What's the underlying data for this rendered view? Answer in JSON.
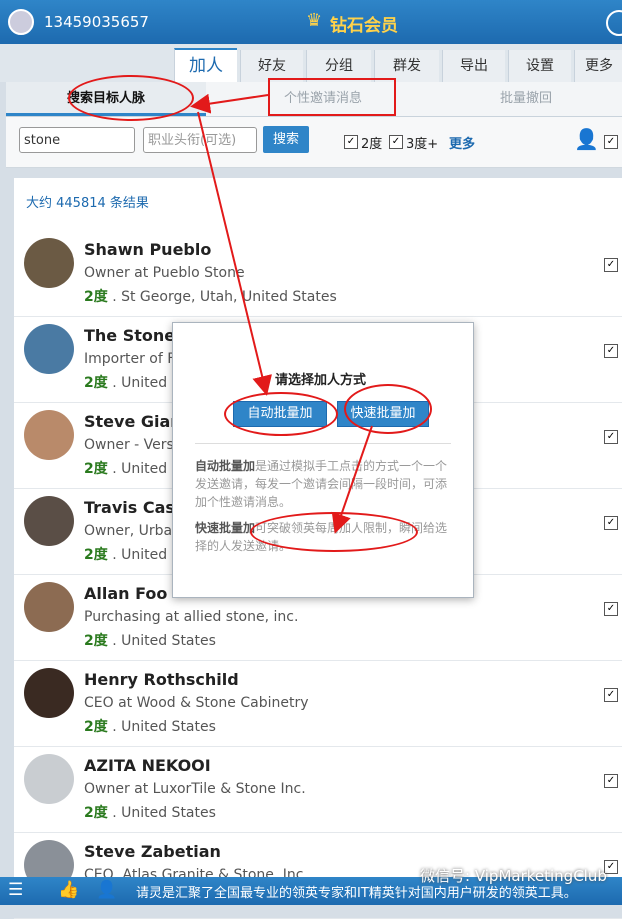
{
  "header": {
    "phone": "13459035657",
    "vip_label": "钻石会员"
  },
  "tabs": [
    "加人",
    "好友",
    "分组",
    "群发",
    "导出",
    "设置",
    "更多"
  ],
  "subtabs": [
    "搜索目标人脉",
    "个性邀请消息",
    "批量撤回"
  ],
  "search": {
    "keyword": "stone",
    "title_placeholder": "职业头衔(可选)",
    "button": "搜索",
    "degree2": "2度",
    "degree3": "3度+",
    "more": "更多"
  },
  "result_count": "大约 445814 条结果",
  "people": [
    {
      "name": "Shawn Pueblo",
      "title": "Owner at Pueblo Stone",
      "degree": "2度",
      "location": ". St George, Utah, United States"
    },
    {
      "name": "The Stone C",
      "title": "Importer of F",
      "degree": "2度",
      "location": ". United S"
    },
    {
      "name": "Steve Giann",
      "title": "Owner - Versa",
      "degree": "2度",
      "location": ". United S"
    },
    {
      "name": "Travis Casc",
      "title": "Owner, Urbar",
      "degree": "2度",
      "location": ". United S"
    },
    {
      "name": "Allan Foo",
      "title": "Purchasing at allied stone, inc.",
      "degree": "2度",
      "location": ". United States"
    },
    {
      "name": "Henry Rothschild",
      "title": "CEO at Wood & Stone Cabinetry",
      "degree": "2度",
      "location": ". United States"
    },
    {
      "name": "AZITA NEKOOI",
      "title": "Owner at LuxorTile & Stone Inc.",
      "degree": "2度",
      "location": ". United States"
    },
    {
      "name": "Steve Zabetian",
      "title": "CEO, Atlas Granite & Stone, Inc",
      "degree": "",
      "location": ""
    }
  ],
  "modal": {
    "title": "请选择加人方式",
    "auto_button": "自动批量加",
    "fast_button": "快速批量加",
    "auto_desc_bold": "自动批量加",
    "auto_desc": "是通过模拟手工点击的方式一个一个发送邀请，每发一个邀请会间隔一段时间，可添加个性邀请消息。",
    "fast_desc_bold": "快速批量加",
    "fast_desc": "可突破领英每周加人限制，瞬间给选择的人发送邀请。"
  },
  "footer": {
    "marquee": "请灵是汇聚了全国最专业的领英专家和IT精英针对国内用户研发的领英工具。"
  },
  "watermark": "微信号: VipMarketingClub",
  "colors": {
    "brand": "#2f85c8",
    "annotation": "#e21a1a",
    "degree": "#2a7a1e"
  }
}
